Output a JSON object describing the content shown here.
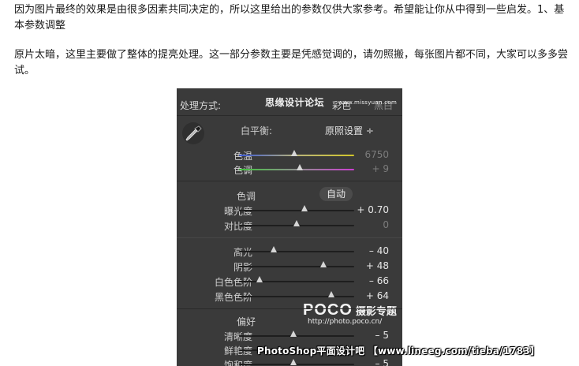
{
  "article": {
    "para1": "因为图片最终的效果是由很多因素共同决定的，所以这里给出的参数仅供大家参考。希望能让你从中得到一些启发。1、基本参数调整",
    "para2": "原片太暗，这里主要做了整体的提亮处理。这一部分参数主要是凭感觉调的，请勿照搬，每张图片都不同，大家可以多多尝试。"
  },
  "panel": {
    "treatment_label": "处理方式:",
    "treatment_color": "彩色",
    "treatment_bw": "黑白",
    "white_balance_label": "白平衡:",
    "white_balance_value": "原照设置 ÷",
    "temp": {
      "label": "色温",
      "value": "6750",
      "level": 0.48
    },
    "tint": {
      "label": "色调",
      "value": "+ 9",
      "level": 0.53
    },
    "tone_label": "色调",
    "auto_label": "自动",
    "exposure": {
      "label": "曝光度",
      "value": "+ 0.70",
      "level": 0.57
    },
    "contrast": {
      "label": "对比度",
      "value": "0",
      "level": 0.5
    },
    "highlights": {
      "label": "高光",
      "value": "– 40",
      "level": 0.3
    },
    "shadows": {
      "label": "阴影",
      "value": "+ 48",
      "level": 0.73
    },
    "whites": {
      "label": "白色色阶",
      "value": "– 66",
      "level": 0.18
    },
    "blacks": {
      "label": "黑色色阶",
      "value": "+ 64",
      "level": 0.8
    },
    "presence_label": "偏好",
    "clarity": {
      "label": "清晰度",
      "value": "– 5",
      "level": 0.47
    },
    "vibrance": {
      "label": "鲜艳度",
      "value": "",
      "level": 0.5
    },
    "saturation": {
      "label": "饱和度",
      "value": "– 5",
      "level": 0.47
    }
  },
  "watermarks": {
    "top_cn": "思缘设计论坛",
    "top_url": "www.missyuan.com",
    "poco_big": "POCO",
    "poco_cn": "摄影专题",
    "poco_url": "http://photo.poco.cn/",
    "bottom": "PhotoShop平面设计吧 【www.lineeg.com/tieba/1783】"
  },
  "colors": {
    "panel_bg": "#3a3a3a",
    "track": "#1e1e1e",
    "thumb": "#d6d6d6"
  }
}
